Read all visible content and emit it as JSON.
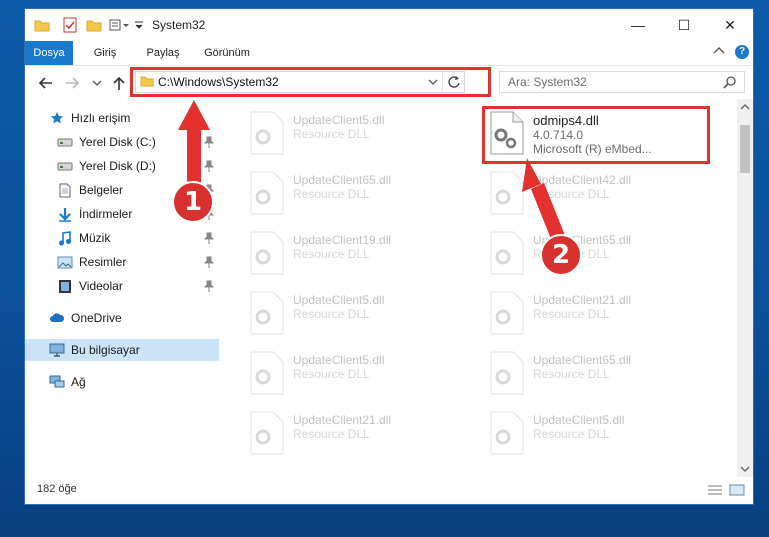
{
  "window": {
    "title": "System32",
    "controls": {
      "minimize": "—",
      "maximize": "☐",
      "close": "✕"
    }
  },
  "ribbon": {
    "tabs": [
      {
        "label": "Dosya",
        "active": true
      },
      {
        "label": "Giriş"
      },
      {
        "label": "Paylaş"
      },
      {
        "label": "Görünüm"
      }
    ]
  },
  "nav": {
    "address": "C:\\Windows\\System32",
    "search_placeholder": "Ara: System32"
  },
  "sidebar": {
    "quick_access": "Hızlı erişim",
    "items": [
      {
        "label": "Yerel Disk (C:)",
        "icon": "drive-icon",
        "pinned": true
      },
      {
        "label": "Yerel Disk (D:)",
        "icon": "drive-icon",
        "pinned": true
      },
      {
        "label": "Belgeler",
        "icon": "documents-icon",
        "pinned": true
      },
      {
        "label": "İndirmeler",
        "icon": "download-icon",
        "pinned": true
      },
      {
        "label": "Müzik",
        "icon": "music-icon",
        "pinned": true
      },
      {
        "label": "Resimler",
        "icon": "pictures-icon",
        "pinned": true
      },
      {
        "label": "Videolar",
        "icon": "videos-icon",
        "pinned": true
      }
    ],
    "onedrive": "OneDrive",
    "this_pc": "Bu bilgisayar",
    "network": "Ağ"
  },
  "files": [
    {
      "name": "UpdateClient5.dll",
      "type": "Resource DLL"
    },
    {
      "name": "odmips4.dll",
      "version": "4.0.714.0",
      "company": "Microsoft (R) eMbed..."
    },
    {
      "name": "UpdateClient65.dll",
      "type": "Resource DLL"
    },
    {
      "name": "UpdateClient42.dll",
      "type": "Resource DLL"
    },
    {
      "name": "UpdateClient19.dll",
      "type": "Resource DLL"
    },
    {
      "name": "UpdateClient65.dll",
      "type": "Resource DLL"
    },
    {
      "name": "UpdateClient5.dll",
      "type": "Resource DLL"
    },
    {
      "name": "UpdateClient21.dll",
      "type": "Resource DLL"
    },
    {
      "name": "UpdateClient5.dll",
      "type": "Resource DLL"
    },
    {
      "name": "UpdateClient65.dll",
      "type": "Resource DLL"
    },
    {
      "name": "UpdateClient21.dll",
      "type": "Resource DLL"
    },
    {
      "name": "UpdateClient5.dll",
      "type": "Resource DLL"
    }
  ],
  "status": {
    "count": "182 öğe"
  },
  "annotations": {
    "step1": "1",
    "step2": "2",
    "color": "#e2312f"
  }
}
